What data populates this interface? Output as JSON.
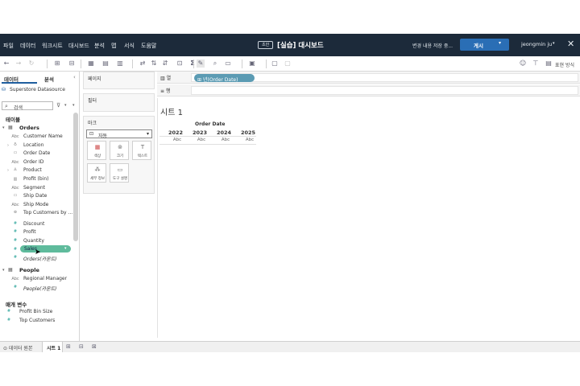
{
  "app": {
    "doc_badge": "초안",
    "doc_title": "[실습] 대시보드",
    "save_status": "변경 내용 저장 중...",
    "publish_label": "게시",
    "user_name": "jeongmin ju",
    "menu": [
      "파일",
      "데이터",
      "워크시트",
      "대시보드",
      "분석",
      "맵",
      "서식",
      "도움말"
    ]
  },
  "toolbar": {
    "show_me": "표현 방식"
  },
  "left_pane": {
    "tab_data": "데이터",
    "tab_analysis": "분석",
    "datasource": "Superstore Datasource",
    "search_placeholder": "검색",
    "tables_header": "테이블",
    "orders": {
      "name": "Orders",
      "fields": [
        {
          "icon": "Abc",
          "name": "Customer Name"
        },
        {
          "icon": "geo",
          "name": "Location"
        },
        {
          "icon": "date",
          "name": "Order Date"
        },
        {
          "icon": "Abc",
          "name": "Order ID"
        },
        {
          "icon": "hier",
          "name": "Product"
        },
        {
          "icon": "Abc",
          "name": "Profit (bin)"
        },
        {
          "icon": "Abc",
          "name": "Segment"
        },
        {
          "icon": "date",
          "name": "Ship Date"
        },
        {
          "icon": "Abc",
          "name": "Ship Mode"
        },
        {
          "icon": "set",
          "name": "Top Customers by ..."
        }
      ],
      "measures": [
        "Discount",
        "Profit",
        "Quantity",
        "Sales"
      ],
      "count": "Orders(카운트)"
    },
    "people": {
      "name": "People",
      "fields": [
        {
          "icon": "Abc",
          "name": "Regional Manager"
        }
      ],
      "count": "People(카운트)"
    },
    "params_header": "매개 변수",
    "params": [
      "Profit Bin Size",
      "Top Customers"
    ]
  },
  "shelves": {
    "pages": "페이지",
    "filters": "필터",
    "marks": "마크",
    "marks_type": "자동",
    "mark_buttons": [
      "색상",
      "크기",
      "텍스트",
      "세부 정보",
      "도구 설명"
    ],
    "columns": "열",
    "rows": "행",
    "columns_pill": "년(Order Date)"
  },
  "view": {
    "sheet_title": "시트 1",
    "header": "Order Date",
    "years": [
      "2022",
      "2023",
      "2024",
      "2025"
    ],
    "cells": [
      "Abc",
      "Abc",
      "Abc",
      "Abc"
    ]
  },
  "bottom": {
    "datasource_tab": "데이터 원본",
    "sheet_tab": "시트 1"
  },
  "colors": {
    "menubar": "#1c2a3a",
    "publish": "#2a6eb5",
    "dimension_pill": "#5b9bb3",
    "measure_pill": "#5fbb9c"
  }
}
